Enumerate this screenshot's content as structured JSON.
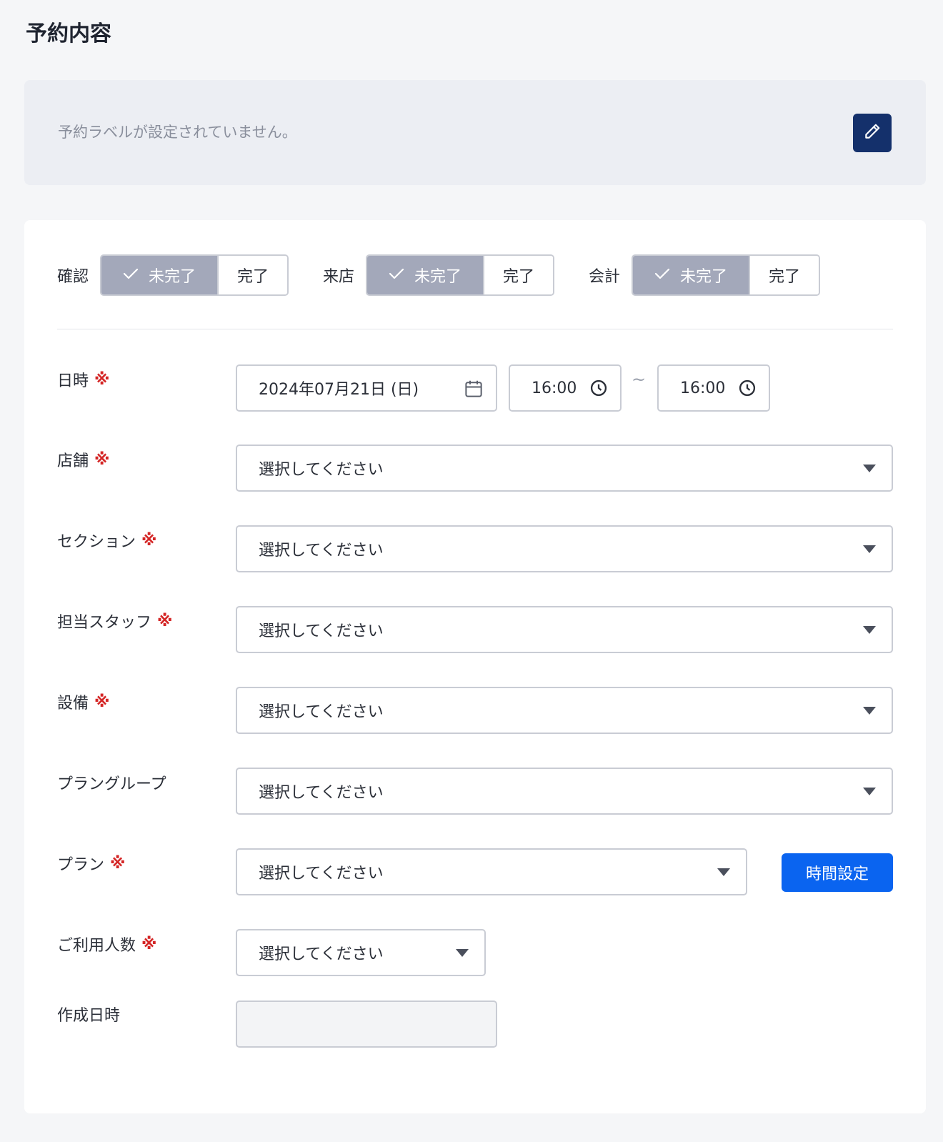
{
  "page": {
    "title": "予約内容"
  },
  "label_panel": {
    "message": "予約ラベルが設定されていません。",
    "edit_icon": "pencil-icon"
  },
  "status": [
    {
      "label": "確認",
      "incomplete": "未完了",
      "complete": "完了",
      "selected": "未完了"
    },
    {
      "label": "来店",
      "incomplete": "未完了",
      "complete": "完了",
      "selected": "未完了"
    },
    {
      "label": "会計",
      "incomplete": "未完了",
      "complete": "完了",
      "selected": "未完了"
    }
  ],
  "required_mark": "※",
  "fields": {
    "datetime": {
      "label": "日時",
      "date": "2024年07月21日 (日)",
      "start": "16:00",
      "end": "16:00",
      "separator": "~"
    },
    "store": {
      "label": "店舗",
      "value": "選択してください"
    },
    "section": {
      "label": "セクション",
      "value": "選択してください"
    },
    "staff": {
      "label": "担当スタッフ",
      "value": "選択してください"
    },
    "equipment": {
      "label": "設備",
      "value": "選択してください"
    },
    "plan_group": {
      "label": "プラングループ",
      "value": "選択してください"
    },
    "plan": {
      "label": "プラン",
      "value": "選択してください",
      "time_button": "時間設定"
    },
    "guests": {
      "label": "ご利用人数",
      "value": "選択してください"
    },
    "created_at": {
      "label": "作成日時",
      "value": ""
    }
  },
  "colors": {
    "primary": "#0a64f0",
    "navy": "#14306b",
    "required": "#d42525",
    "selected_segment": "#a3a8ba"
  }
}
